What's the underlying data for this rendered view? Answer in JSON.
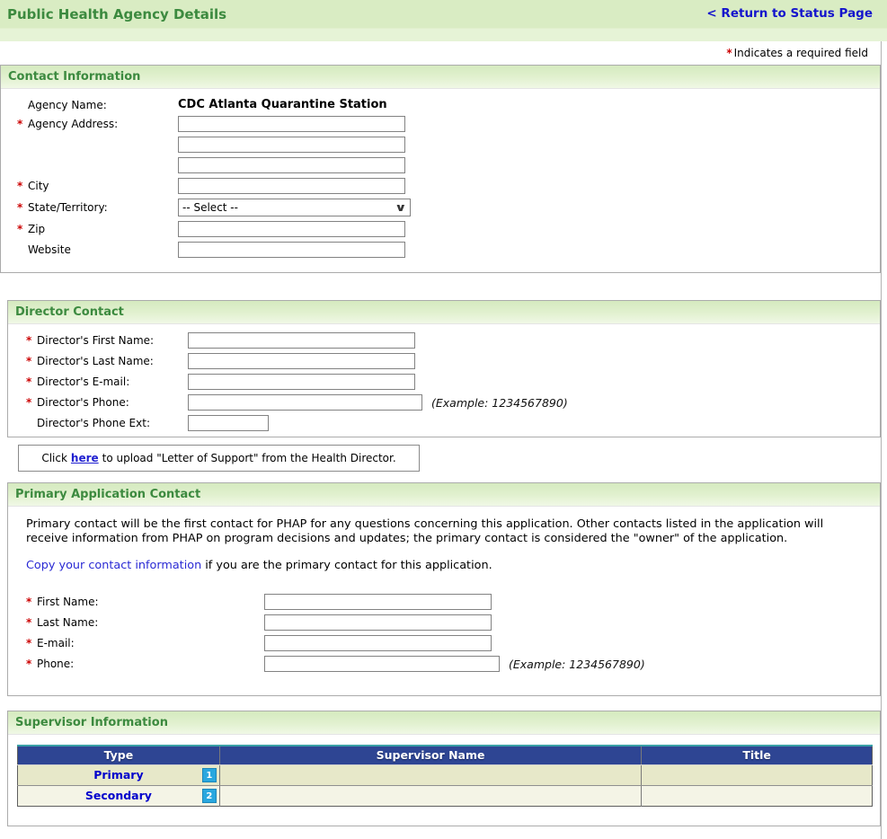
{
  "header": {
    "title": "Public Health Agency Details",
    "return_link": "< Return to Status Page"
  },
  "required_note": {
    "asterisk": "*",
    "text": "Indicates a required field"
  },
  "contact": {
    "title": "Contact Information",
    "agency_name_label": "Agency Name:",
    "agency_name_value": "CDC Atlanta Quarantine Station",
    "agency_address_label": "Agency Address:",
    "city_label": "City",
    "state_label": "State/Territory:",
    "state_selected_value": "-- Select --",
    "zip_label": "Zip",
    "website_label": "Website"
  },
  "director": {
    "title": "Director Contact",
    "fields": [
      {
        "label": "Director's First Name:"
      },
      {
        "label": "Director's Last Name:"
      },
      {
        "label": "Director's E-mail:"
      },
      {
        "label": "Director's Phone:"
      },
      {
        "label": "Director's Phone Ext:"
      }
    ],
    "phone_example": "(Example: 1234567890)",
    "upload": {
      "pre": "Click",
      "link": "here",
      "post": "to upload \"Letter of Support\" from the Health Director."
    }
  },
  "primary": {
    "title": "Primary Application Contact",
    "description": "Primary contact will be the first contact for PHAP for any questions concerning this application. Other contacts listed in the application will receive information from PHAP on program decisions and updates; the primary contact is considered the \"owner\" of the application.",
    "copy_link": "Copy your contact information",
    "copy_suffix": " if you are the primary contact for this application.",
    "fields": [
      {
        "label": "First Name:"
      },
      {
        "label": "Last Name:"
      },
      {
        "label": "E-mail:"
      },
      {
        "label": "Phone:"
      }
    ],
    "phone_example": "(Example: 1234567890)"
  },
  "supervisor": {
    "title": "Supervisor Information",
    "columns": [
      "Type",
      "Supervisor Name",
      "Title"
    ],
    "rows": [
      {
        "type": "Primary",
        "badge": "1",
        "name": "",
        "job_title": ""
      },
      {
        "type": "Secondary",
        "badge": "2",
        "name": "",
        "job_title": ""
      }
    ]
  },
  "colors": {
    "section_header_green": "#3c8a3f",
    "bar_green": "#d9ecc3",
    "link_blue": "#1414cc",
    "required_red": "#cc0000",
    "table_header_navy": "#2e4593",
    "badge_cyan": "#29a7df",
    "row_beige_dark": "#e7e8c9",
    "row_beige_light": "#f4f4e6"
  }
}
